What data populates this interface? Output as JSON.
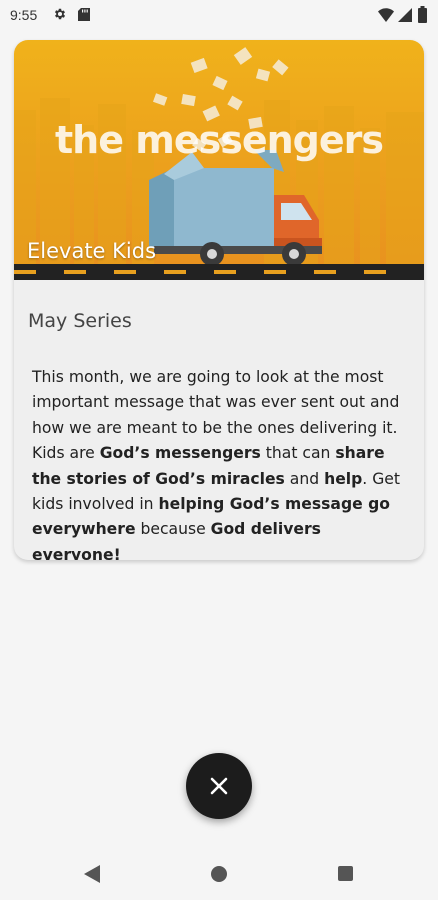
{
  "status_bar": {
    "time": "9:55",
    "icons": [
      "gear-icon",
      "sd-card-icon",
      "wifi-icon",
      "signal-icon",
      "battery-icon"
    ]
  },
  "card": {
    "banner": {
      "title": "the messengers",
      "caption": "Elevate Kids",
      "colors": {
        "top": "#f0b21b",
        "bottom": "#e8901f",
        "truck_cargo": "#8fb8cf",
        "truck_cab": "#e0662a"
      }
    },
    "series_label": "May Series",
    "description": [
      {
        "text": "This month, we are going to look at the most important message that was ever sent out and how we are meant to be the ones delivering it. Kids are ",
        "bold": false
      },
      {
        "text": "God’s messengers",
        "bold": true
      },
      {
        "text": " that can ",
        "bold": false
      },
      {
        "text": "share the stories of God’s miracles",
        "bold": true
      },
      {
        "text": " and ",
        "bold": false
      },
      {
        "text": "help",
        "bold": true
      },
      {
        "text": ". Get kids involved in ",
        "bold": false
      },
      {
        "text": "helping God’s message go everywhere",
        "bold": true
      },
      {
        "text": " because ",
        "bold": false
      },
      {
        "text": "God delivers everyone!",
        "bold": true
      }
    ]
  },
  "fab": {
    "icon": "close-icon"
  },
  "nav_bar": {
    "icons": [
      "back-icon",
      "home-icon",
      "recents-icon"
    ]
  }
}
